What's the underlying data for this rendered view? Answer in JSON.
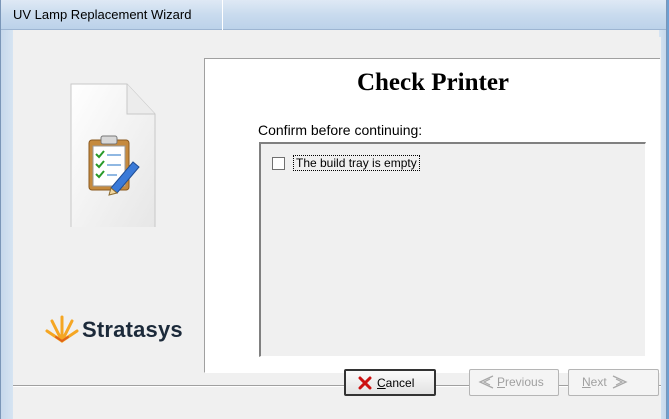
{
  "window": {
    "title": "UV Lamp Replacement Wizard"
  },
  "brand": {
    "name": "Stratasys"
  },
  "panel": {
    "title": "Check Printer",
    "prompt": "Confirm before continuing:"
  },
  "checklist": {
    "items": [
      {
        "label": "The build tray is empty",
        "checked": false
      }
    ]
  },
  "buttons": {
    "cancel": {
      "hotkey": "C",
      "rest": "ancel",
      "icon": "red-x-icon",
      "enabled": true
    },
    "previous": {
      "hotkey": "P",
      "rest": "revious",
      "icon": "chevron-left-icon",
      "enabled": false
    },
    "next": {
      "hotkey": "N",
      "rest": "ext",
      "icon": "chevron-right-icon",
      "enabled": false
    }
  },
  "colors": {
    "title_gradient_top": "#dfe9f5",
    "cancel_icon": "#cc1111",
    "brand_text": "#1c2a3a",
    "brand_burst": "#f5a623"
  }
}
